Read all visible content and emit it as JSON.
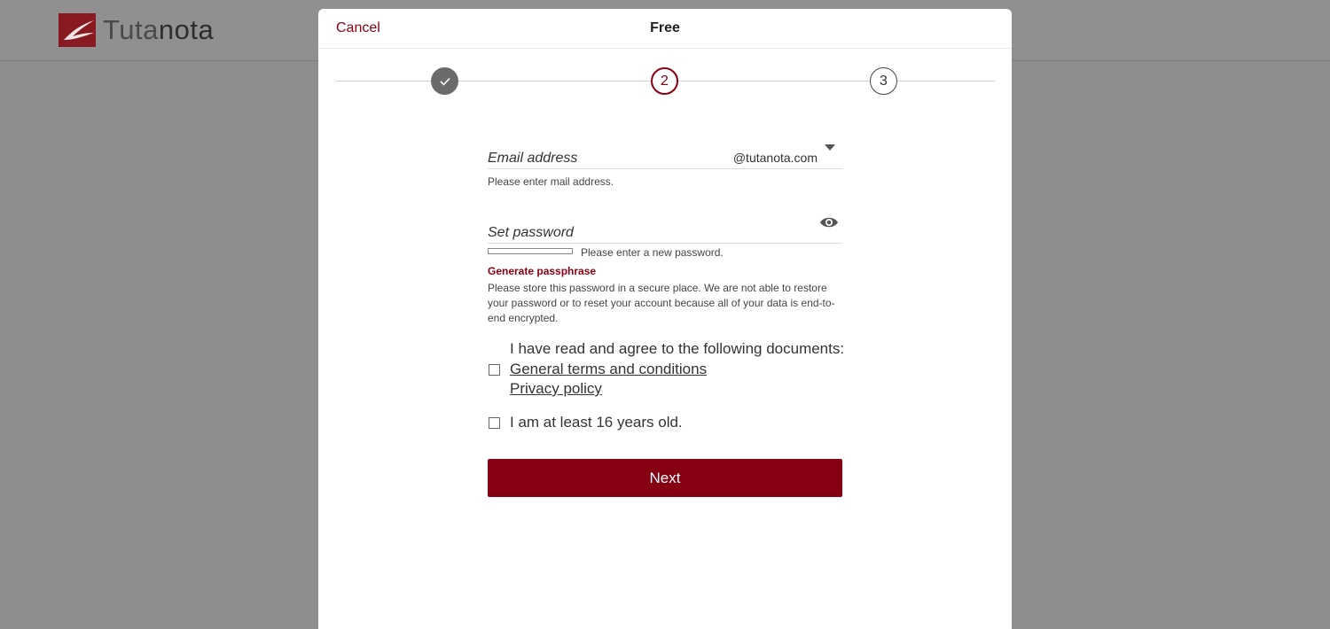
{
  "app": {
    "logo_text_part1": "Tuta",
    "logo_text_part2": "nota"
  },
  "dialog": {
    "cancel_label": "Cancel",
    "title": "Free",
    "steps": [
      {
        "label": "",
        "state": "done",
        "icon": "check-icon"
      },
      {
        "label": "2",
        "state": "active"
      },
      {
        "label": "3",
        "state": "todo"
      }
    ]
  },
  "form": {
    "email": {
      "label": "Email address",
      "value": "",
      "domain": "@tutanota.com",
      "helper": "Please enter mail address."
    },
    "password": {
      "label": "Set password",
      "value": "",
      "strength": 0,
      "helper": "Please enter a new password.",
      "visibility_icon": "eye-icon"
    },
    "generate_label": "Generate passphrase",
    "notice": "Please store this password in a secure place. We are not able to restore your password or to reset your account because all of your data is end-to-end encrypted.",
    "terms": {
      "intro": "I have read and agree to the following documents:",
      "link_terms": "General terms and conditions",
      "link_privacy": "Privacy policy",
      "checked": false
    },
    "age": {
      "label": "I am at least 16 years old.",
      "checked": false
    },
    "next_label": "Next"
  },
  "colors": {
    "accent": "#850013",
    "overlay": "#8e8e8e",
    "dialog_bg": "#ffffff"
  }
}
